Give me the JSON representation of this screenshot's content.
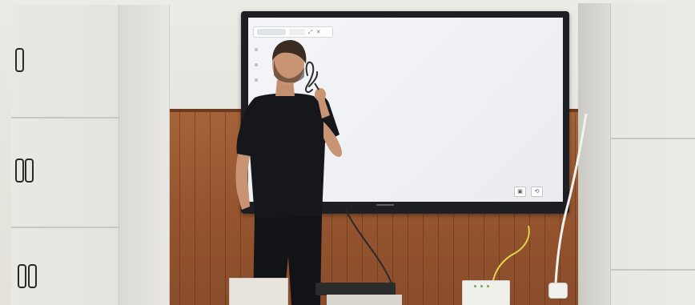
{
  "scene": {
    "description_free": true,
    "colors": {
      "wall": "#e6e5df",
      "wood": "#96552f",
      "cabinet": "#e7e6e1",
      "monitor_bezel": "#1d1f24",
      "screen": "#eef0f4",
      "shirt": "#15171b",
      "skin": "#c99474",
      "hair": "#3a2c22",
      "ink": "#2b2b2b"
    },
    "icons": {
      "toolbar_close": "✕",
      "toolbar_expand": "⤢",
      "corner_left": "▣",
      "corner_right": "⟲"
    }
  },
  "screen_ui": {
    "toolbar_tabs": [
      "",
      ""
    ]
  }
}
